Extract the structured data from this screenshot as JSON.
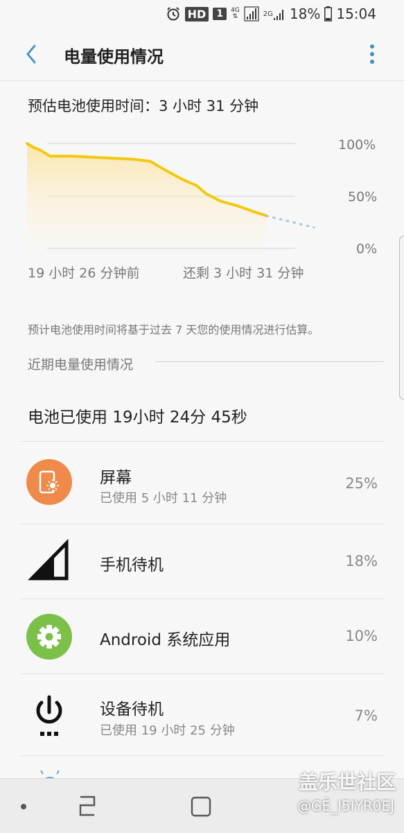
{
  "status_bar": {
    "hd": "HD",
    "sim": "1",
    "net_top": "4G",
    "net_2g": "2G",
    "battery": "18%",
    "time": "15:04"
  },
  "app_bar": {
    "title": "电量使用情况"
  },
  "estimate": "预估电池使用时间：3 小时 31 分钟",
  "chart_data": {
    "type": "area",
    "y_ticks": [
      "100%",
      "50%",
      "0%"
    ],
    "x_labels": [
      "19 小时 26 分钟前",
      "还剩 3 小时 31 分钟"
    ],
    "ylim": [
      0,
      100
    ],
    "series": [
      {
        "values": [
          [
            0,
            100
          ],
          [
            5,
            96
          ],
          [
            9,
            94
          ],
          [
            16,
            88
          ],
          [
            30,
            88
          ],
          [
            45,
            87
          ],
          [
            60,
            86
          ],
          [
            75,
            85
          ],
          [
            86,
            83
          ],
          [
            96,
            75
          ],
          [
            108,
            66
          ],
          [
            118,
            60
          ],
          [
            125,
            52
          ],
          [
            135,
            45
          ],
          [
            148,
            40
          ],
          [
            158,
            35
          ],
          [
            167,
            31
          ]
        ]
      },
      {
        "values": [
          [
            167,
            31
          ],
          [
            185,
            25
          ],
          [
            200,
            20
          ]
        ],
        "projected": true
      }
    ],
    "grid": true,
    "line_color": "#f2c811"
  },
  "note": "预计电池使用时间将基于过去 7 天您的使用情况进行估算。",
  "section_title": "近期电量使用情况",
  "total_used": "电池已使用 19小时 24分 45秒",
  "items": [
    {
      "name": "屏幕",
      "sub": "已使用 5 小时 11 分钟",
      "pct": "25%",
      "icon": "screen-brightness-icon"
    },
    {
      "name": "手机待机",
      "sub": "",
      "pct": "18%",
      "icon": "cell-signal-icon"
    },
    {
      "name": "Android 系统应用",
      "sub": "",
      "pct": "10%",
      "icon": "android-gear-icon"
    },
    {
      "name": "设备待机",
      "sub": "已使用 19 小时 25 分钟",
      "pct": "7%",
      "icon": "power-standby-icon"
    }
  ],
  "watermark": {
    "line1": "盖乐世社区",
    "line2": "@GÉ_I5IYR0EJ"
  },
  "colors": {
    "accent": "#3e8fc7",
    "screen_icon_bg": "#ef8a4b",
    "android_icon_bg": "#7cc04a"
  }
}
